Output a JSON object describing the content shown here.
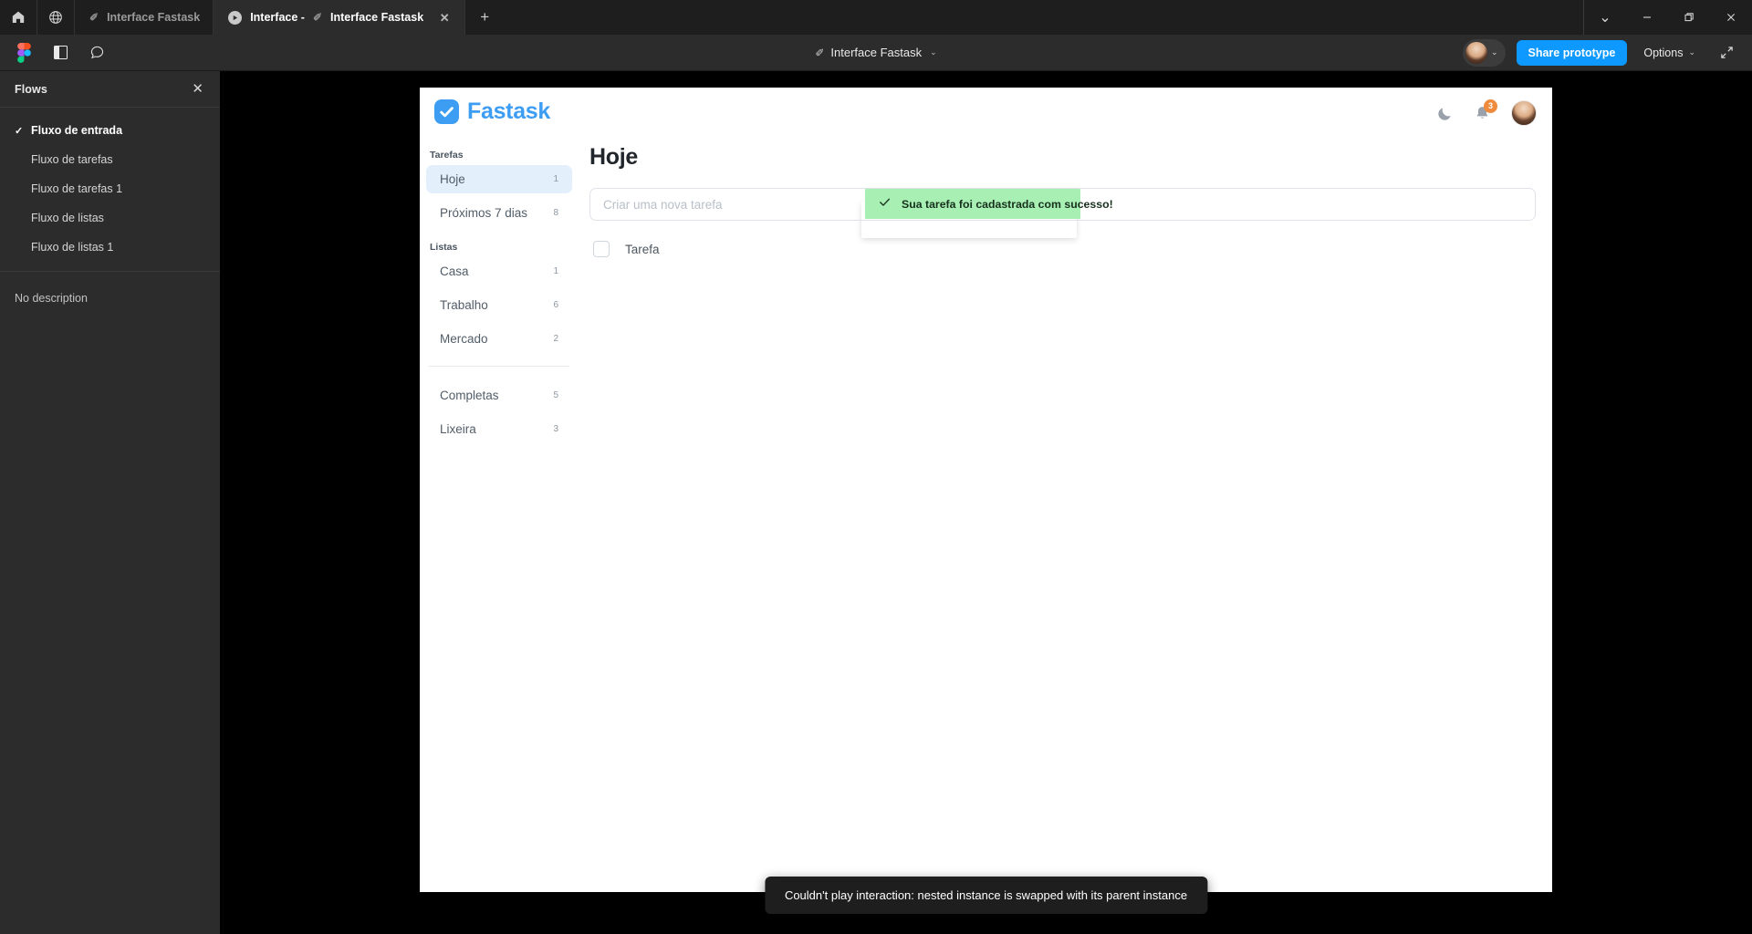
{
  "window": {
    "tabs": [
      {
        "label": "Interface Fastask",
        "icon": "pen-icon",
        "active": false
      },
      {
        "label": "Interface - ✏ Interface Fastask",
        "prefix": "Interface -",
        "name": "Interface Fastask",
        "icon": "play-icon",
        "active": true
      }
    ],
    "home_icon": "home-icon",
    "globe_icon": "globe-icon",
    "new_tab_label": "+",
    "close_tab_label": "✕",
    "controls": {
      "chevron": "⌄",
      "minimize": "—",
      "maximize": "❐",
      "close": "✕"
    }
  },
  "figma_toolbar": {
    "logo": "figma-logo",
    "panel_toggle": "panel-toggle-icon",
    "comment": "comment-icon",
    "file_title": "Interface Fastask",
    "file_title_chevron": "⌄",
    "avatar_chevron": "⌄",
    "share_label": "Share prototype",
    "options_label": "Options",
    "options_chevron": "⌄",
    "fullscreen_icon": "fullscreen-icon",
    "accent_color": "#0d99ff"
  },
  "flows_panel": {
    "title": "Flows",
    "close_label": "✕",
    "selected_index": 0,
    "check_glyph": "✓",
    "items": [
      {
        "label": "Fluxo de entrada"
      },
      {
        "label": "Fluxo de tarefas"
      },
      {
        "label": "Fluxo de tarefas 1"
      },
      {
        "label": "Fluxo de listas"
      },
      {
        "label": "Fluxo de listas 1"
      }
    ],
    "description": "No description"
  },
  "app": {
    "logo_text": "Fastask",
    "logo_color": "#3d9df3",
    "header": {
      "theme_toggle_icon": "moon-icon",
      "notifications_icon": "bell-icon",
      "notifications_count": "3",
      "badge_color": "#f08a3c",
      "avatar": "user-avatar"
    },
    "toast": {
      "icon": "check-icon",
      "message": "Sua tarefa foi cadastrada com sucesso!",
      "background": "#a8efb3"
    },
    "sidebar": {
      "groups": [
        {
          "title": "Tarefas",
          "items": [
            {
              "label": "Hoje",
              "count": "1",
              "active": true
            },
            {
              "label": "Próximos 7 dias",
              "count": "8",
              "active": false
            }
          ]
        },
        {
          "title": "Listas",
          "items": [
            {
              "label": "Casa",
              "count": "1",
              "active": false
            },
            {
              "label": "Trabalho",
              "count": "6",
              "active": false
            },
            {
              "label": "Mercado",
              "count": "2",
              "active": false
            }
          ]
        }
      ],
      "footer_items": [
        {
          "label": "Completas",
          "count": "5"
        },
        {
          "label": "Lixeira",
          "count": "3"
        }
      ]
    },
    "main": {
      "heading": "Hoje",
      "new_task_placeholder": "Criar uma nova tarefa",
      "tasks": [
        {
          "label": "Tarefa",
          "checked": false
        }
      ]
    }
  },
  "status_toast": {
    "message": "Couldn't play interaction: nested instance is swapped with its parent instance"
  }
}
